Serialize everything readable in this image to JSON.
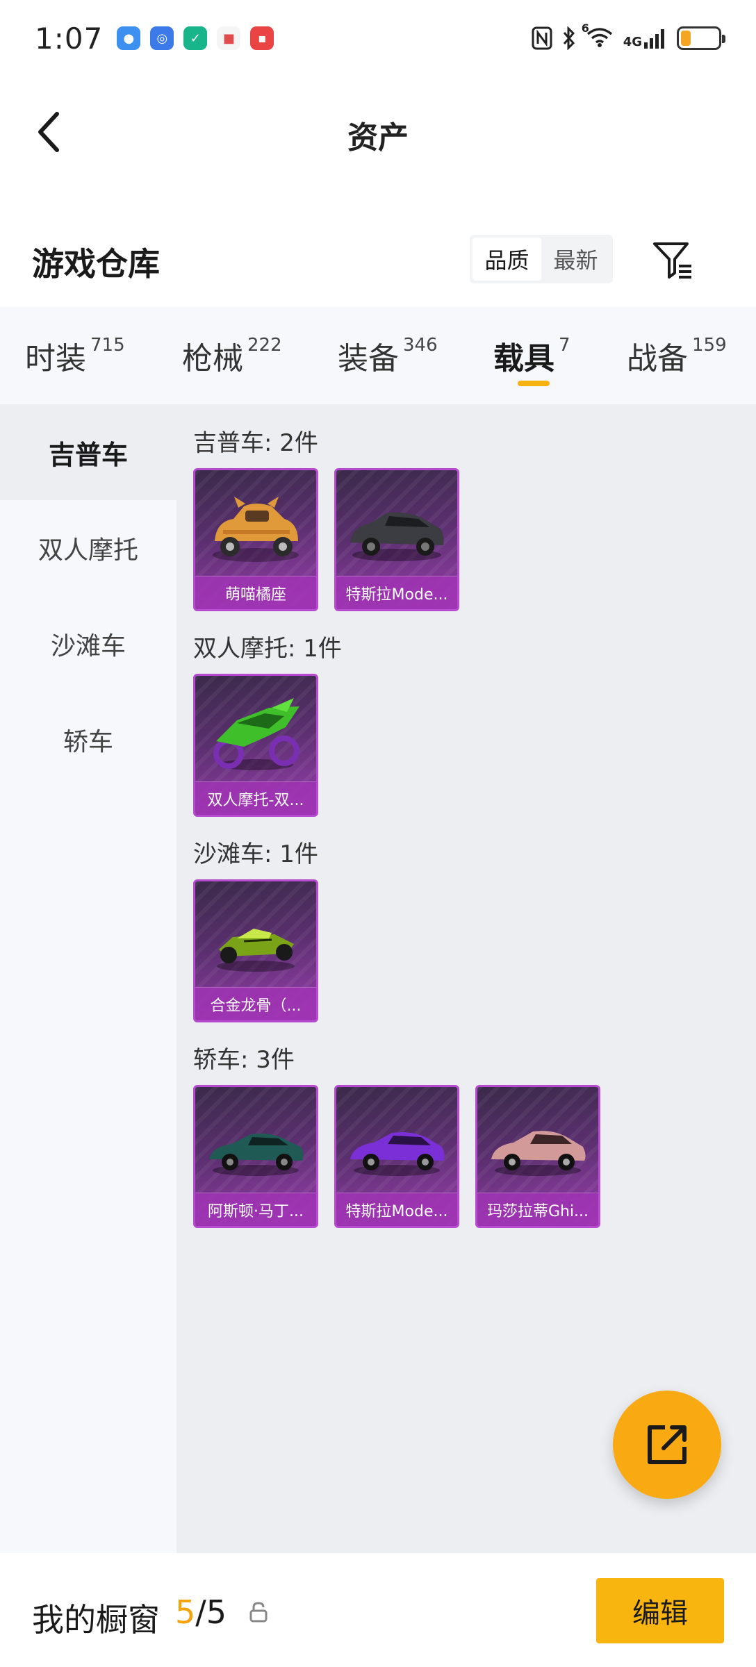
{
  "status_bar": {
    "time": "1:07",
    "network_label": "4G",
    "signal_superscript": "6"
  },
  "header": {
    "title": "资产"
  },
  "warehouse": {
    "title": "游戏仓库",
    "sort_options": [
      "品质",
      "最新"
    ],
    "sort_selected": "品质"
  },
  "tabs": [
    {
      "label": "时装",
      "count": "715"
    },
    {
      "label": "枪械",
      "count": "222"
    },
    {
      "label": "装备",
      "count": "346"
    },
    {
      "label": "载具",
      "count": "7",
      "active": true
    },
    {
      "label": "战备",
      "count": "159"
    }
  ],
  "sidebar": {
    "items": [
      "吉普车",
      "双人摩托",
      "沙滩车",
      "轿车"
    ],
    "active": "吉普车"
  },
  "groups": [
    {
      "title": "吉普车: 2件",
      "items": [
        {
          "name": "萌喵橘座"
        },
        {
          "name": "特斯拉Mode..."
        }
      ]
    },
    {
      "title": "双人摩托: 1件",
      "items": [
        {
          "name": "双人摩托-双..."
        }
      ]
    },
    {
      "title": "沙滩车: 1件",
      "items": [
        {
          "name": "合金龙骨（..."
        }
      ]
    },
    {
      "title": "轿车: 3件",
      "items": [
        {
          "name": "阿斯顿·马丁..."
        },
        {
          "name": "特斯拉Mode..."
        },
        {
          "name": "玛莎拉蒂Ghi..."
        }
      ]
    }
  ],
  "bottom_bar": {
    "title": "我的橱窗",
    "count_current": "5",
    "count_separator": "/5",
    "edit_label": "编辑"
  },
  "colors": {
    "accent": "#f9b50f",
    "card_border": "#b74bd0"
  }
}
